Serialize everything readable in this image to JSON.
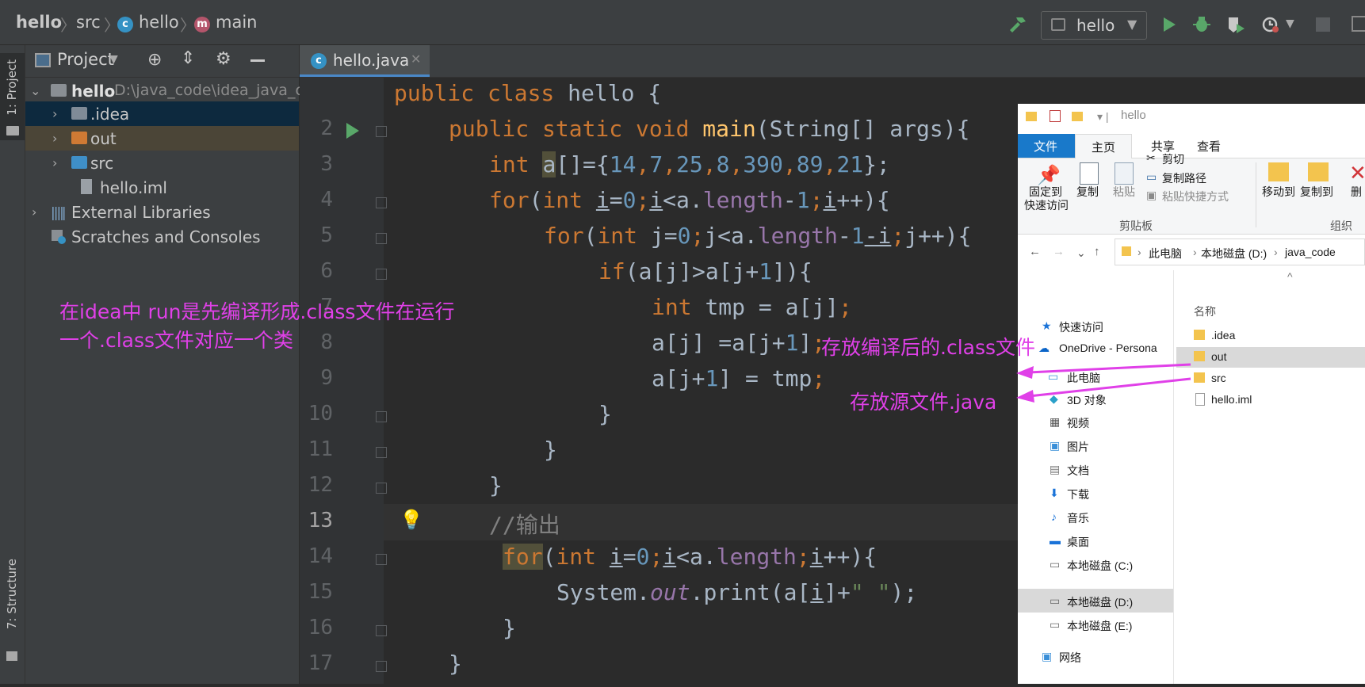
{
  "breadcrumb": {
    "project": "hello",
    "src": "src",
    "cls": "hello",
    "method": "main"
  },
  "run_config": {
    "label": "hello"
  },
  "tool_strip": {
    "project": "1: Project",
    "structure": "7: Structure"
  },
  "project_panel": {
    "title": "Project",
    "root_name": "hello",
    "root_path": "D:\\java_code\\idea_java_code\\hello",
    "items": [
      ".idea",
      "out",
      "src",
      "hello.iml",
      "External Libraries",
      "Scratches and Consoles"
    ]
  },
  "editor_tab": {
    "label": "hello.java"
  },
  "line_numbers": [
    "2",
    "3",
    "4",
    "5",
    "6",
    "7",
    "8",
    "9",
    "10",
    "11",
    "12",
    "13",
    "14",
    "15",
    "16",
    "17"
  ],
  "code": {
    "l1": {
      "kw": "public class ",
      "name": "hello {"
    },
    "l2": {
      "kw": "public static void ",
      "fn": "main",
      "rest": "(String[] args){"
    },
    "l3": {
      "kw": "int ",
      "var": "a",
      "p1": "[]={",
      "n1": "14",
      "n2": "7",
      "n3": "25",
      "n4": "8",
      "n5": "390",
      "n6": "89",
      "n7": "21",
      "p2": "};",
      "comma": ","
    },
    "l4": {
      "kw": "for",
      "p1": "(",
      "kw2": "int ",
      "i": "i",
      "eq": "=",
      "zero": "0",
      "semi": ";",
      "lt": "<a.",
      "fld": "length",
      "minus": "-",
      "one": "1",
      "pp": "++){"
    },
    "l5": {
      "j": "j",
      "ltlen": "<a.",
      "mi": "-i",
      "pp": "++){"
    },
    "l6": {
      "kw": "if",
      "txt": "(a[j]>a[j+",
      "one": "1",
      "end": "]){"
    },
    "l7": {
      "kw": "int ",
      "txt": "tmp = a[j]",
      "semi": ";"
    },
    "l8": {
      "txt": "a[j] =a[j+",
      "one": "1",
      "end": "]",
      "semi": ";"
    },
    "l9": {
      "txt": "a[j+",
      "one": "1",
      "end": "] = tmp",
      "semi": ";"
    },
    "brace": "}",
    "l13": {
      "cmt": "//输出"
    },
    "l14": {
      "kw": "for",
      "p1": "(",
      "kw2": "int ",
      "i": "i",
      "eq": "=",
      "zero": "0",
      "semi": ";",
      "lt": "<a.",
      "fld": "length",
      "pp": "++){"
    },
    "l15": {
      "sys": "System.",
      "out": "out",
      "print": ".print(a[",
      "i": "i",
      "rest": "]+",
      "str": "\" \"",
      "end": ");"
    }
  },
  "explorer": {
    "title": "hello",
    "ribbon_tabs": [
      "文件",
      "主页",
      "共享",
      "查看"
    ],
    "pin_label": [
      "固定到",
      "快速访问"
    ],
    "copy": "复制",
    "paste": "粘贴",
    "cut": "剪切",
    "copy_path": "复制路径",
    "paste_shortcut": "粘贴快捷方式",
    "clipboard_group": "剪贴板",
    "move_to": "移动到",
    "copy_to": "复制到",
    "delete": "删",
    "organize_group": "组织",
    "address": [
      "此电脑",
      "本地磁盘 (D:)",
      "java_code"
    ],
    "column_name": "名称",
    "nav_items": [
      "快速访问",
      "OneDrive - Persona",
      "此电脑",
      "3D 对象",
      "视频",
      "图片",
      "文档",
      "下载",
      "音乐",
      "桌面",
      "本地磁盘 (C:)",
      "本地磁盘 (D:)",
      "本地磁盘 (E:)",
      "网络"
    ],
    "files": [
      ".idea",
      "out",
      "src",
      "hello.iml"
    ]
  },
  "annotations": {
    "run_note1": "在idea中 run是先编译形成.class文件在运行",
    "run_note2": "一个.class文件对应一个类",
    "out_note": "存放编译后的.class文件",
    "src_note": "存放源文件.java"
  },
  "colors": {
    "annotation": "#e040e8",
    "keyword": "#cc7832",
    "number": "#6897bb",
    "field": "#9876aa"
  }
}
